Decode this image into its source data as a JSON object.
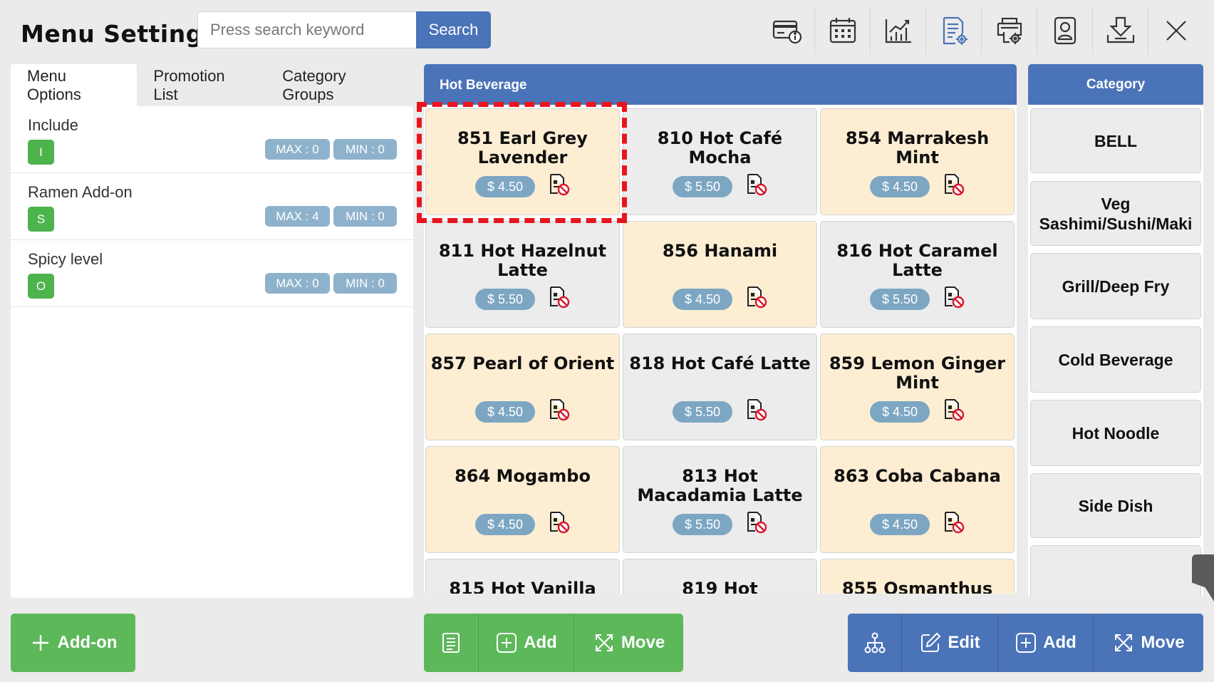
{
  "header": {
    "title": "Menu Setting",
    "search_placeholder": "Press search keyword",
    "search_label": "Search",
    "toolbar_icons": [
      "card-info-icon",
      "calendar-icon",
      "chart-icon",
      "document-settings-icon",
      "printer-settings-icon",
      "profile-icon",
      "download-icon",
      "close-icon"
    ]
  },
  "tabs": [
    "Menu Options",
    "Promotion List",
    "Category Groups"
  ],
  "options": [
    {
      "label": "Include",
      "badge": "I",
      "max": "MAX : 0",
      "min": "MIN : 0"
    },
    {
      "label": "Ramen Add-on",
      "badge": "S",
      "max": "MAX : 4",
      "min": "MIN : 0"
    },
    {
      "label": "Spicy level",
      "badge": "O",
      "max": "MAX : 0",
      "min": "MIN : 0"
    }
  ],
  "menu": {
    "category_title": "Hot Beverage",
    "items": [
      {
        "name": "851 Earl Grey Lavender",
        "price": "$ 4.50",
        "tone": "cream",
        "selected": true
      },
      {
        "name": "810 Hot Café Mocha",
        "price": "$ 5.50",
        "tone": "gray"
      },
      {
        "name": "854 Marrakesh Mint",
        "price": "$ 4.50",
        "tone": "cream"
      },
      {
        "name": "811 Hot Hazelnut Latte",
        "price": "$ 5.50",
        "tone": "gray"
      },
      {
        "name": "856 Hanami",
        "price": "$ 4.50",
        "tone": "cream"
      },
      {
        "name": "816 Hot Caramel Latte",
        "price": "$ 5.50",
        "tone": "gray"
      },
      {
        "name": "857 Pearl of Orient",
        "price": "$ 4.50",
        "tone": "cream"
      },
      {
        "name": "818 Hot Café Latte",
        "price": "$ 5.50",
        "tone": "gray"
      },
      {
        "name": "859 Lemon Ginger Mint",
        "price": "$ 4.50",
        "tone": "cream"
      },
      {
        "name": "864 Mogambo",
        "price": "$ 4.50",
        "tone": "cream"
      },
      {
        "name": "813 Hot Macadamia Latte",
        "price": "$ 5.50",
        "tone": "gray"
      },
      {
        "name": "863 Coba Cabana",
        "price": "$ 4.50",
        "tone": "cream"
      },
      {
        "name": "815 Hot Vanilla",
        "price": "",
        "tone": "gray"
      },
      {
        "name": "819 Hot",
        "price": "",
        "tone": "gray"
      },
      {
        "name": "855 Osmanthus",
        "price": "",
        "tone": "cream"
      }
    ]
  },
  "category": {
    "title": "Category",
    "items": [
      "BELL",
      "Veg Sashimi/Sushi/Maki",
      "Grill/Deep Fry",
      "Cold Beverage",
      "Hot Noodle",
      "Side Dish"
    ]
  },
  "bottom": {
    "addon_label": "Add-on",
    "menu_actions": [
      "Add",
      "Move"
    ],
    "category_actions": [
      "Edit",
      "Add",
      "Move"
    ]
  },
  "colors": {
    "accent": "#4a73b8",
    "green": "#5db85a",
    "cream": "#fdeed3",
    "highlight": "#e8141e"
  }
}
